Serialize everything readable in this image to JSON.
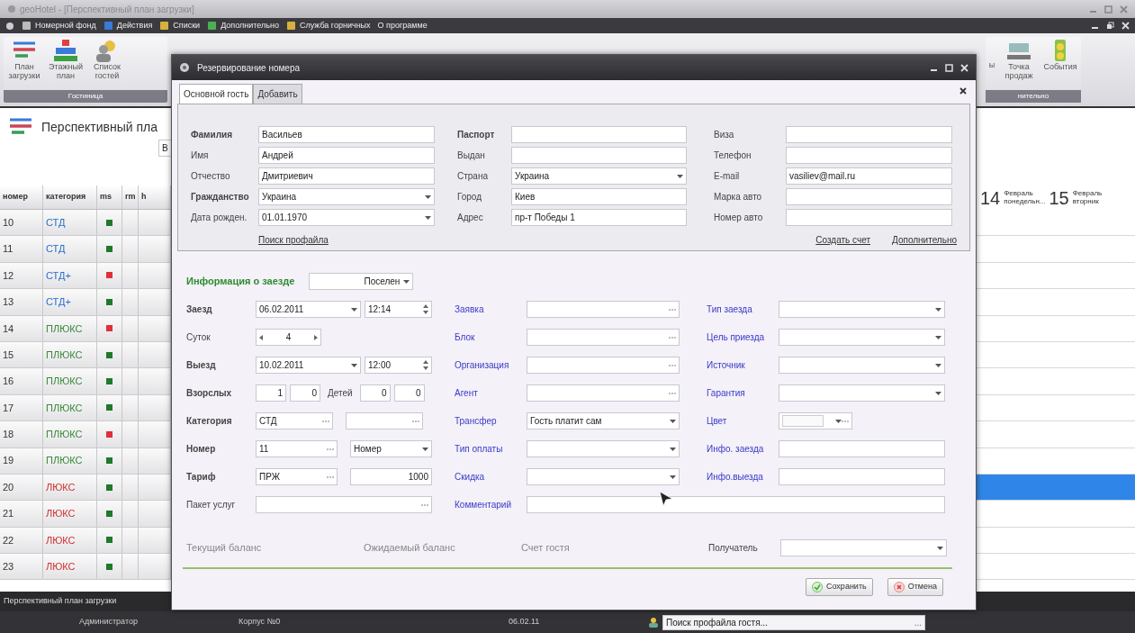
{
  "window": {
    "title": "geoHotel - [Перспективный план загрузки]"
  },
  "menu": [
    {
      "label": "Номерной фонд"
    },
    {
      "label": "Действия"
    },
    {
      "label": "Списки"
    },
    {
      "label": "Дополнительно"
    },
    {
      "label": "Служба горничных"
    },
    {
      "label": "О программе"
    }
  ],
  "ribbon": {
    "left_group": {
      "label": "Гостиница",
      "items": [
        {
          "label": "План загрузки",
          "kind": "plan"
        },
        {
          "label": "Этажный план",
          "kind": "floor"
        },
        {
          "label": "Список гостей",
          "kind": "guests"
        }
      ]
    },
    "right_group": {
      "label": "нительно",
      "cut_label": "ы",
      "items": [
        {
          "label": "Точка продаж",
          "kind": "pos"
        },
        {
          "label": "События",
          "kind": "events"
        }
      ]
    }
  },
  "page": {
    "title": "Перспективный пла",
    "filter_fragment": "В"
  },
  "grid": {
    "columns": [
      "номер",
      "категория",
      "ms",
      "rm",
      "h"
    ],
    "timeline": [
      {
        "day": "14",
        "month": "Февраль",
        "weekday": "понедельн..."
      },
      {
        "day": "15",
        "month": "Февраль",
        "weekday": "вторник"
      }
    ],
    "rows": [
      {
        "number": "10",
        "category": {
          "label": "СТД",
          "color": "#2a6fc9"
        },
        "status": {
          "color": "#1f7a2a"
        },
        "selected": false
      },
      {
        "number": "11",
        "category": {
          "label": "СТД",
          "color": "#2a6fc9"
        },
        "status": {
          "color": "#1f7a2a"
        },
        "selected": false
      },
      {
        "number": "12",
        "category": {
          "label": "СТД+",
          "color": "#2a6fc9"
        },
        "status": {
          "color": "#e0303a"
        },
        "selected": false
      },
      {
        "number": "13",
        "category": {
          "label": "СТД+",
          "color": "#2a6fc9"
        },
        "status": {
          "color": "#1f7a2a"
        },
        "selected": false
      },
      {
        "number": "14",
        "category": {
          "label": "ПЛЮКС",
          "color": "#3a8a3a"
        },
        "status": {
          "color": "#e0303a"
        },
        "selected": false
      },
      {
        "number": "15",
        "category": {
          "label": "ПЛЮКС",
          "color": "#3a8a3a"
        },
        "status": {
          "color": "#1f7a2a"
        },
        "selected": false
      },
      {
        "number": "16",
        "category": {
          "label": "ПЛЮКС",
          "color": "#3a8a3a"
        },
        "status": {
          "color": "#1f7a2a"
        },
        "selected": false
      },
      {
        "number": "17",
        "category": {
          "label": "ПЛЮКС",
          "color": "#3a8a3a"
        },
        "status": {
          "color": "#1f7a2a"
        },
        "selected": false
      },
      {
        "number": "18",
        "category": {
          "label": "ПЛЮКС",
          "color": "#3a8a3a"
        },
        "status": {
          "color": "#e0303a"
        },
        "selected": false
      },
      {
        "number": "19",
        "category": {
          "label": "ПЛЮКС",
          "color": "#3a8a3a"
        },
        "status": {
          "color": "#1f7a2a"
        },
        "selected": false
      },
      {
        "number": "20",
        "category": {
          "label": "ЛЮКС",
          "color": "#d0302f"
        },
        "status": {
          "color": "#1f7a2a"
        },
        "selected": true
      },
      {
        "number": "21",
        "category": {
          "label": "ЛЮКС",
          "color": "#d0302f"
        },
        "status": {
          "color": "#1f7a2a"
        },
        "selected": false
      },
      {
        "number": "22",
        "category": {
          "label": "ЛЮКС",
          "color": "#d0302f"
        },
        "status": {
          "color": "#1f7a2a"
        },
        "selected": false
      },
      {
        "number": "23",
        "category": {
          "label": "ЛЮКС",
          "color": "#d0302f"
        },
        "status": {
          "color": "#1f7a2a"
        },
        "selected": false
      }
    ]
  },
  "bottom_tab": {
    "label": "Перспективный план загрузки"
  },
  "status_bar": {
    "user": "Администратор",
    "building": "Корпус №0",
    "date": "06.02.11",
    "search": {
      "value": "Поиск профайла гостя...",
      "button": "..."
    }
  },
  "dialog": {
    "title": "Резервирование номера",
    "tabs": [
      {
        "label": "Основной гость",
        "selected": true
      },
      {
        "label": "Добавить",
        "selected": false
      }
    ],
    "guest": {
      "columns": [
        [
          {
            "label": "Фамилия",
            "bold": true,
            "kind": "text",
            "value": "Васильев"
          },
          {
            "label": "Имя",
            "bold": false,
            "kind": "text",
            "value": "Андрей"
          },
          {
            "label": "Отчество",
            "bold": false,
            "kind": "text",
            "value": "Дмитриевич"
          },
          {
            "label": "Гражданство",
            "bold": true,
            "kind": "dropdown",
            "value": "Украина"
          },
          {
            "label": "Дата рожден.",
            "bold": false,
            "kind": "date",
            "value": "01.01.1970"
          }
        ],
        [
          {
            "label": "Паспорт",
            "bold": true,
            "kind": "text"
          },
          {
            "label": "Выдан",
            "bold": false,
            "kind": "text"
          },
          {
            "label": "Страна",
            "bold": false,
            "kind": "dropdown",
            "value": "Украина"
          },
          {
            "label": "Город",
            "bold": false,
            "kind": "text",
            "value": "Киев"
          },
          {
            "label": "Адрес",
            "bold": false,
            "kind": "text",
            "value": "пр-т Победы 1"
          }
        ],
        [
          {
            "label": "Виза",
            "bold": false,
            "kind": "text"
          },
          {
            "label": "Телефон",
            "bold": false,
            "kind": "text"
          },
          {
            "label": "E-mail",
            "bold": false,
            "kind": "text",
            "value": "vasiliev@mail.ru"
          },
          {
            "label": "Марка авто",
            "bold": false,
            "kind": "text"
          },
          {
            "label": "Номер авто",
            "bold": false,
            "kind": "text"
          }
        ]
      ],
      "links": [
        "Поиск профайла",
        "Создать счет",
        "Дополнительно"
      ]
    },
    "stay": {
      "heading": "Информация о заезде",
      "status": "Поселен",
      "left": [
        {
          "label": "Заезд",
          "bold": true,
          "controls": [
            {
              "kind": "date",
              "value": "06.02.2011"
            },
            {
              "kind": "time",
              "value": "12:14"
            }
          ]
        },
        {
          "label": "Суток",
          "bold": false,
          "controls": [
            {
              "kind": "stepper",
              "value": "4"
            }
          ]
        },
        {
          "label": "Выезд",
          "bold": true,
          "controls": [
            {
              "kind": "date",
              "value": "10.02.2011"
            },
            {
              "kind": "time",
              "value": "12:00"
            }
          ]
        },
        {
          "label": "Взорслых",
          "bold": true,
          "controls": [
            {
              "kind": "number",
              "value": "1"
            },
            {
              "kind": "number",
              "value": "0"
            },
            {
              "kind": "label",
              "value": "Детей"
            },
            {
              "kind": "number",
              "value": "0"
            },
            {
              "kind": "number",
              "value": "0"
            }
          ]
        },
        {
          "label": "Категория",
          "bold": true,
          "controls": [
            {
              "kind": "lookup",
              "value": "СТД"
            },
            {
              "kind": "lookup"
            }
          ]
        },
        {
          "label": "Номер",
          "bold": true,
          "controls": [
            {
              "kind": "lookup",
              "value": "11"
            },
            {
              "kind": "dropdown",
              "value": "Номер"
            }
          ]
        },
        {
          "label": "Тариф",
          "bold": true,
          "controls": [
            {
              "kind": "lookup",
              "value": "ПРЖ"
            },
            {
              "kind": "amount",
              "value": "1000"
            }
          ]
        },
        {
          "label": "Пакет услуг",
          "bold": false,
          "controls": [
            {
              "kind": "lookup"
            }
          ]
        }
      ],
      "middle": [
        {
          "label": "Заявка",
          "kind": "lookup"
        },
        {
          "label": "Блок",
          "kind": "lookup"
        },
        {
          "label": "Организация",
          "kind": "lookup"
        },
        {
          "label": "Агент",
          "kind": "lookup"
        },
        {
          "label": "Трансфер",
          "kind": "dropdown",
          "value": "Гость платит сам"
        },
        {
          "label": "Тип оплаты",
          "kind": "dropdown"
        },
        {
          "label": "Скидка",
          "kind": "dropdown"
        }
      ],
      "right": [
        {
          "label": "Тип заезда",
          "kind": "dropdown"
        },
        {
          "label": "Цель приезда",
          "kind": "dropdown"
        },
        {
          "label": "Источник",
          "kind": "dropdown"
        },
        {
          "label": "Гарантия",
          "kind": "dropdown"
        },
        {
          "label": "Цвет",
          "kind": "color"
        },
        {
          "label": "Инфо. заезда",
          "kind": "text"
        },
        {
          "label": "Инфо.выезда",
          "kind": "text"
        }
      ],
      "comment": {
        "label": "Комментарий"
      }
    },
    "balance": {
      "labels": [
        "Текущий баланс",
        "Ожидаемый баланс",
        "Счет гостя"
      ],
      "recipient": {
        "label": "Получатель"
      }
    },
    "buttons": [
      {
        "label": "Сохранить",
        "kind": "save"
      },
      {
        "label": "Отмена",
        "kind": "cancel"
      }
    ]
  }
}
